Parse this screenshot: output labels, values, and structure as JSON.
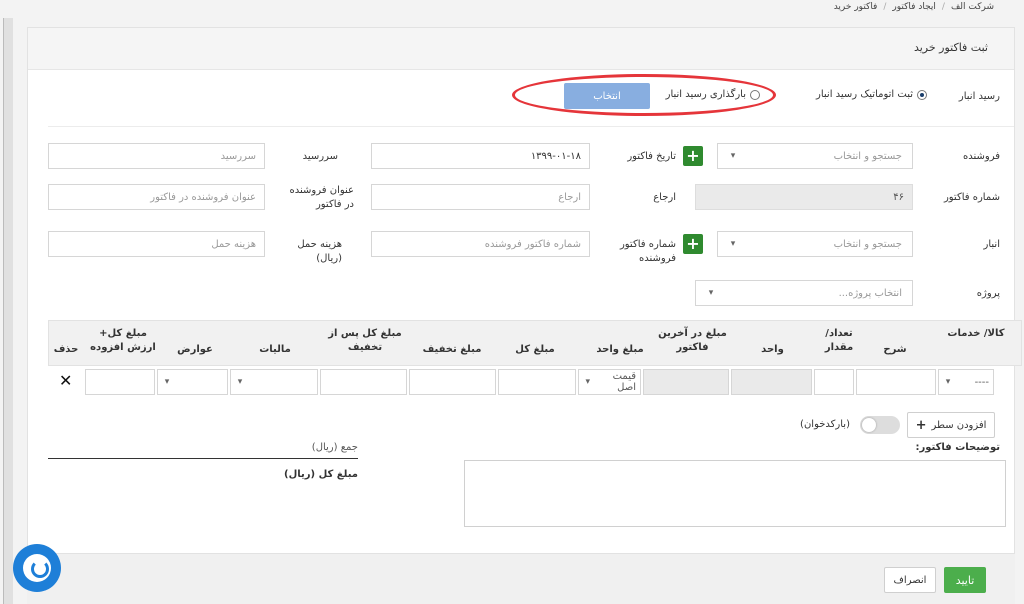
{
  "breadcrumb": {
    "item1": "شرکت الف",
    "item2": "ایجاد فاکتور",
    "item3": "فاکتور خرید",
    "separator": "/"
  },
  "panel": {
    "title": "ثبت فاکتور خرید"
  },
  "receipt": {
    "label": "رسید انبار",
    "option_auto": "ثبت اتوماتیک رسید انبار",
    "option_load": "بارگذاری رسید انبار",
    "select_button": "انتخاب"
  },
  "form": {
    "supplier_label": "فروشنده",
    "supplier_placeholder": "جستجو و انتخاب",
    "invoice_date_label": "تاریخ فاکتور",
    "invoice_date_value": "۱۳۹۹-۰۱-۱۸",
    "due_label": "سررسید",
    "due_placeholder": "سررسید",
    "invoice_number_label": "شماره فاکتور",
    "invoice_number_value": "۴۶",
    "reference_label": "ارجاع",
    "reference_placeholder": "ارجاع",
    "supplier_title_label": "عنوان فروشنده در فاکتور",
    "supplier_title_placeholder": "عنوان فروشنده در فاکتور",
    "warehouse_label": "انبار",
    "warehouse_placeholder": "جستجو و انتخاب",
    "supplier_invoice_number_label": "شماره فاکتور فروشنده",
    "supplier_invoice_number_placeholder": "شماره فاکتور فروشنده",
    "shipping_label": "هزینه حمل (ریال)",
    "shipping_placeholder": "هزینه حمل",
    "project_label": "پروژه",
    "project_placeholder": "انتخاب پروژه..."
  },
  "table": {
    "headers": {
      "goods": "کالا/ خدمات",
      "desc": "شرح",
      "qty": "تعداد/ مقدار",
      "unit": "واحد",
      "last_price": "مبلغ در آخرین فاکتور",
      "unit_price": "مبلغ واحد",
      "total": "مبلغ کل",
      "discount": "مبلغ تخفیف",
      "after_discount": "مبلغ کل پس از تخفیف",
      "tax": "مالیات",
      "duties": "عوارض",
      "total_vat": "مبلغ کل+ ارزش افزوده",
      "delete": "حذف"
    },
    "row": {
      "goods_value": "----",
      "price_type": "قیمت اصل"
    }
  },
  "controls": {
    "add_row": "افزودن سطر",
    "barcode": "(بارکدخوان)",
    "notes_label": "توضیحات فاکتور:",
    "sum_label": "جمع (ریال)",
    "grand_total_label": "مبلغ کل (ریال)"
  },
  "footer": {
    "confirm": "تایید",
    "cancel": "انصراف"
  },
  "colors": {
    "accent": "#88aee0",
    "green": "#2f8a2f",
    "highlight": "#e5353a",
    "confirm": "#4cae4c"
  }
}
